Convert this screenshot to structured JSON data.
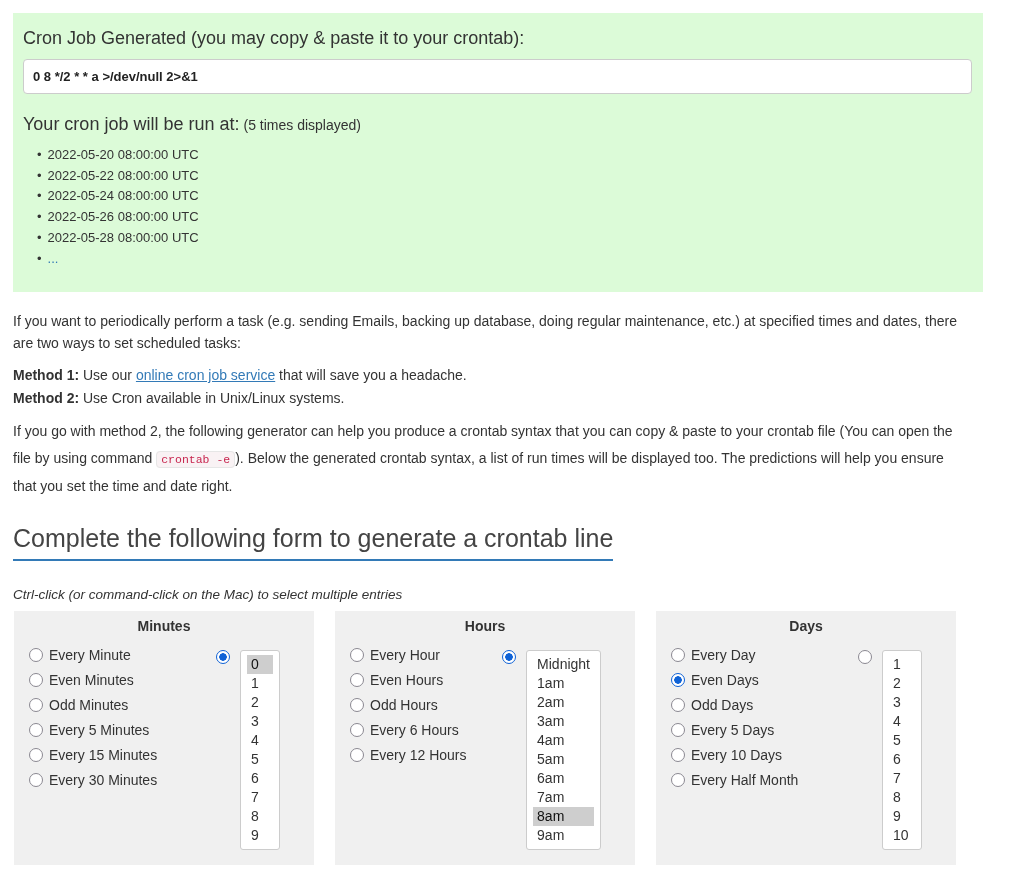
{
  "generated": {
    "title": "Cron Job Generated (you may copy & paste it to your crontab):",
    "command": "0 8 */2 * * a >/dev/null 2>&1"
  },
  "run_times": {
    "title": "Your cron job will be run at:",
    "note": "(5 times displayed)",
    "times": [
      "2022-05-20 08:00:00 UTC",
      "2022-05-22 08:00:00 UTC",
      "2022-05-24 08:00:00 UTC",
      "2022-05-26 08:00:00 UTC",
      "2022-05-28 08:00:00 UTC"
    ],
    "more": "...",
    "bullet": "•"
  },
  "intro": "If you want to periodically perform a task (e.g. sending Emails, backing up database, doing regular maintenance, etc.) at specified times and dates, there are two ways to set scheduled tasks:",
  "methods": [
    {
      "before": "**Method 1:** Use our ",
      "link": "online cron job service",
      "after": " that will save you a headache."
    },
    {
      "before": "**Method 2:** Use Cron available in Unix/Linux systems."
    }
  ],
  "generator_note": {
    "before": "If you go with method 2, the following generator can help you produce a crontab syntax that you can copy & paste to your crontab file (You can open the file by using command ",
    "code": "crontab -e",
    "after": "). Below the generated crontab syntax, a list of run times will be displayed too. The predictions will help you ensure that you set the time and date right."
  },
  "form_heading": "Complete the following form to generate a crontab line",
  "hint": "Ctrl-click (or command-click on the Mac) to select multiple entries",
  "panels": [
    {
      "title": "Minutes",
      "options": [
        {
          "label": "Every Minute",
          "selected": false
        },
        {
          "label": "Even Minutes",
          "selected": false
        },
        {
          "label": "Odd Minutes",
          "selected": false
        },
        {
          "label": "Every 5 Minutes",
          "selected": false
        },
        {
          "label": "Every 15 Minutes",
          "selected": false
        },
        {
          "label": "Every 30 Minutes",
          "selected": false
        }
      ],
      "specific_selected": true,
      "list": [
        {
          "label": "0",
          "selected": true
        },
        {
          "label": "1",
          "selected": false
        },
        {
          "label": "2",
          "selected": false
        },
        {
          "label": "3",
          "selected": false
        },
        {
          "label": "4",
          "selected": false
        },
        {
          "label": "5",
          "selected": false
        },
        {
          "label": "6",
          "selected": false
        },
        {
          "label": "7",
          "selected": false
        },
        {
          "label": "8",
          "selected": false
        },
        {
          "label": "9",
          "selected": false
        }
      ]
    },
    {
      "title": "Hours",
      "options": [
        {
          "label": "Every Hour",
          "selected": false
        },
        {
          "label": "Even Hours",
          "selected": false
        },
        {
          "label": "Odd Hours",
          "selected": false
        },
        {
          "label": "Every 6 Hours",
          "selected": false
        },
        {
          "label": "Every 12 Hours",
          "selected": false
        }
      ],
      "specific_selected": true,
      "list": [
        {
          "label": "Midnight",
          "selected": false
        },
        {
          "label": "1am",
          "selected": false
        },
        {
          "label": "2am",
          "selected": false
        },
        {
          "label": "3am",
          "selected": false
        },
        {
          "label": "4am",
          "selected": false
        },
        {
          "label": "5am",
          "selected": false
        },
        {
          "label": "6am",
          "selected": false
        },
        {
          "label": "7am",
          "selected": false
        },
        {
          "label": "8am",
          "selected": true
        },
        {
          "label": "9am",
          "selected": false
        }
      ]
    },
    {
      "title": "Days",
      "options": [
        {
          "label": "Every Day",
          "selected": false
        },
        {
          "label": "Even Days",
          "selected": true
        },
        {
          "label": "Odd Days",
          "selected": false
        },
        {
          "label": "Every 5 Days",
          "selected": false
        },
        {
          "label": "Every 10 Days",
          "selected": false
        },
        {
          "label": "Every Half Month",
          "selected": false
        }
      ],
      "specific_selected": false,
      "list": [
        {
          "label": "1",
          "selected": false
        },
        {
          "label": "2",
          "selected": false
        },
        {
          "label": "3",
          "selected": false
        },
        {
          "label": "4",
          "selected": false
        },
        {
          "label": "5",
          "selected": false
        },
        {
          "label": "6",
          "selected": false
        },
        {
          "label": "7",
          "selected": false
        },
        {
          "label": "8",
          "selected": false
        },
        {
          "label": "9",
          "selected": false
        },
        {
          "label": "10",
          "selected": false
        }
      ]
    }
  ]
}
